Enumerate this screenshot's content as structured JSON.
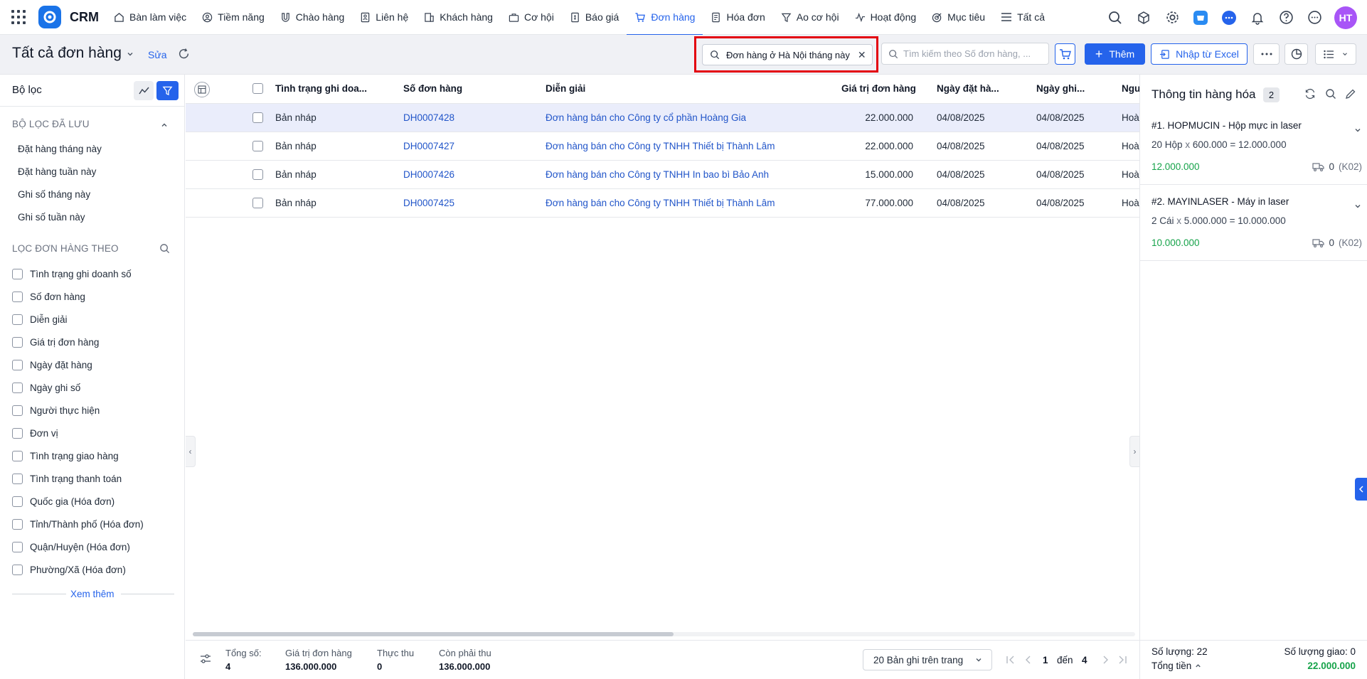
{
  "brand": "CRM",
  "nav": [
    {
      "label": "Bàn làm việc",
      "icon": "house-icon"
    },
    {
      "label": "Tiềm năng",
      "icon": "person-icon"
    },
    {
      "label": "Chào hàng",
      "icon": "magnet-icon"
    },
    {
      "label": "Liên hệ",
      "icon": "contact-icon"
    },
    {
      "label": "Khách hàng",
      "icon": "building-icon"
    },
    {
      "label": "Cơ hội",
      "icon": "briefcase-icon"
    },
    {
      "label": "Báo giá",
      "icon": "quote-icon"
    },
    {
      "label": "Đơn hàng",
      "icon": "cart-icon",
      "active": true
    },
    {
      "label": "Hóa đơn",
      "icon": "invoice-icon"
    },
    {
      "label": "Ao cơ hội",
      "icon": "funnel-icon"
    },
    {
      "label": "Hoạt động",
      "icon": "activity-icon"
    },
    {
      "label": "Mục tiêu",
      "icon": "target-icon"
    },
    {
      "label": "Tất cả",
      "icon": "menu-icon"
    }
  ],
  "user": {
    "initials": "HT"
  },
  "header": {
    "title": "Tất cả đơn hàng",
    "edit_label": "Sửa",
    "search_chip": "Đơn hàng ở Hà Nội tháng này",
    "search_placeholder": "Tìm kiếm theo Số đơn hàng, ...",
    "add_label": "Thêm",
    "import_label": "Nhập từ Excel"
  },
  "filter_panel": {
    "title": "Bộ lọc",
    "saved_heading": "BỘ LỌC ĐÃ LƯU",
    "saved": [
      "Đặt hàng tháng này",
      "Đặt hàng tuần này",
      "Ghi số tháng này",
      "Ghi số tuần này"
    ],
    "by_heading": "LỌC ĐƠN HÀNG THEO",
    "fields": [
      "Tình trạng ghi doanh số",
      "Số đơn hàng",
      "Diễn giải",
      "Giá trị đơn hàng",
      "Ngày đặt hàng",
      "Ngày ghi số",
      "Người thực hiện",
      "Đơn vị",
      "Tình trạng giao hàng",
      "Tình trạng thanh toán",
      "Quốc gia (Hóa đơn)",
      "Tỉnh/Thành phố (Hóa đơn)",
      "Quận/Huyện (Hóa đơn)",
      "Phường/Xã (Hóa đơn)"
    ],
    "more_label": "Xem thêm"
  },
  "table": {
    "columns": [
      "Tình trạng ghi doa...",
      "Số đơn hàng",
      "Diễn giải",
      "Giá trị đơn hàng",
      "Ngày đặt hà...",
      "Ngày ghi...",
      "Ngư"
    ],
    "rows": [
      {
        "status": "Bản nháp",
        "id": "DH0007428",
        "desc": "Đơn hàng bán cho Công ty cổ phần Hoàng Gia",
        "value": "22.000.000",
        "order_date": "04/08/2025",
        "record_date": "04/08/2025",
        "person": "Hoà"
      },
      {
        "status": "Bản nháp",
        "id": "DH0007427",
        "desc": "Đơn hàng bán cho Công ty TNHH Thiết bị Thành Lâm",
        "value": "22.000.000",
        "order_date": "04/08/2025",
        "record_date": "04/08/2025",
        "person": "Hoà"
      },
      {
        "status": "Bản nháp",
        "id": "DH0007426",
        "desc": "Đơn hàng bán cho Công ty TNHH In bao bì Bảo Anh",
        "value": "15.000.000",
        "order_date": "04/08/2025",
        "record_date": "04/08/2025",
        "person": "Hoà"
      },
      {
        "status": "Bản nháp",
        "id": "DH0007425",
        "desc": "Đơn hàng bán cho Công ty TNHH Thiết bị Thành Lâm",
        "value": "77.000.000",
        "order_date": "04/08/2025",
        "record_date": "04/08/2025",
        "person": "Hoà"
      }
    ]
  },
  "footer": {
    "total_label": "Tổng số:",
    "total": "4",
    "value_label": "Giá trị đơn hàng",
    "value": "136.000.000",
    "received_label": "Thực thu",
    "received": "0",
    "remaining_label": "Còn phải thu",
    "remaining": "136.000.000",
    "page_size": "20 Bản ghi trên trang",
    "page_from": "1",
    "page_sep": "đến",
    "page_to": "4"
  },
  "products": {
    "title": "Thông tin hàng hóa",
    "count": "2",
    "items": [
      {
        "name": "#1. HOPMUCIN - Hộp mực in laser",
        "qty": "20 Hộp",
        "x": "x",
        "price": "600.000 = 12.000.000",
        "total": "12.000.000",
        "delivered": "0",
        "code": "(K02)"
      },
      {
        "name": "#2. MAYINLASER - Máy in laser",
        "qty": "2 Cái",
        "x": "x",
        "price": "5.000.000 = 10.000.000",
        "total": "10.000.000",
        "delivered": "0",
        "code": "(K02)"
      }
    ],
    "qty_summary": "Số lượng: 22",
    "delivered_summary": "Số lượng giao: 0",
    "total_label": "Tổng tiền",
    "total_value": "22.000.000"
  }
}
